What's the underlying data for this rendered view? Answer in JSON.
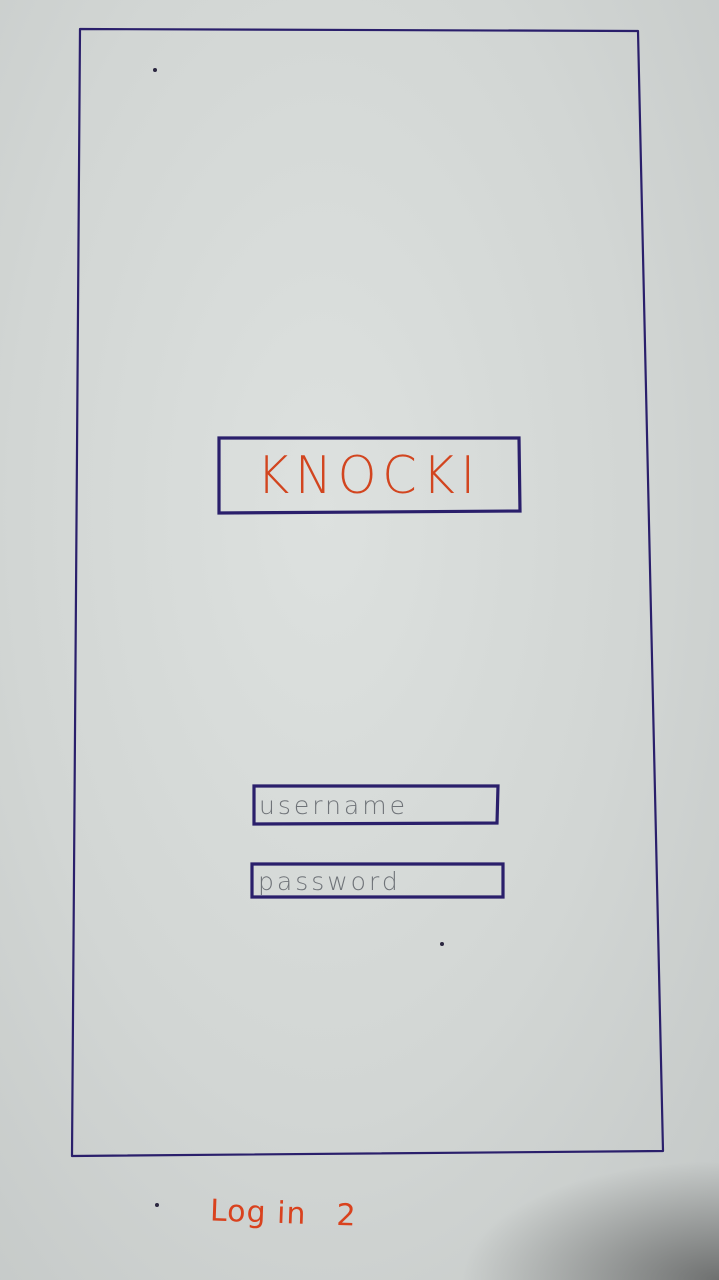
{
  "app": {
    "logo_text": "KNOCKI"
  },
  "login_form": {
    "username_placeholder": "username",
    "password_placeholder": "password"
  },
  "caption": {
    "title": "Log in",
    "number": "2"
  },
  "colors": {
    "ink": "#2a1f6b",
    "accent": "#d2451f",
    "placeholder": "#6f7378",
    "paper": "#d6dad8"
  }
}
